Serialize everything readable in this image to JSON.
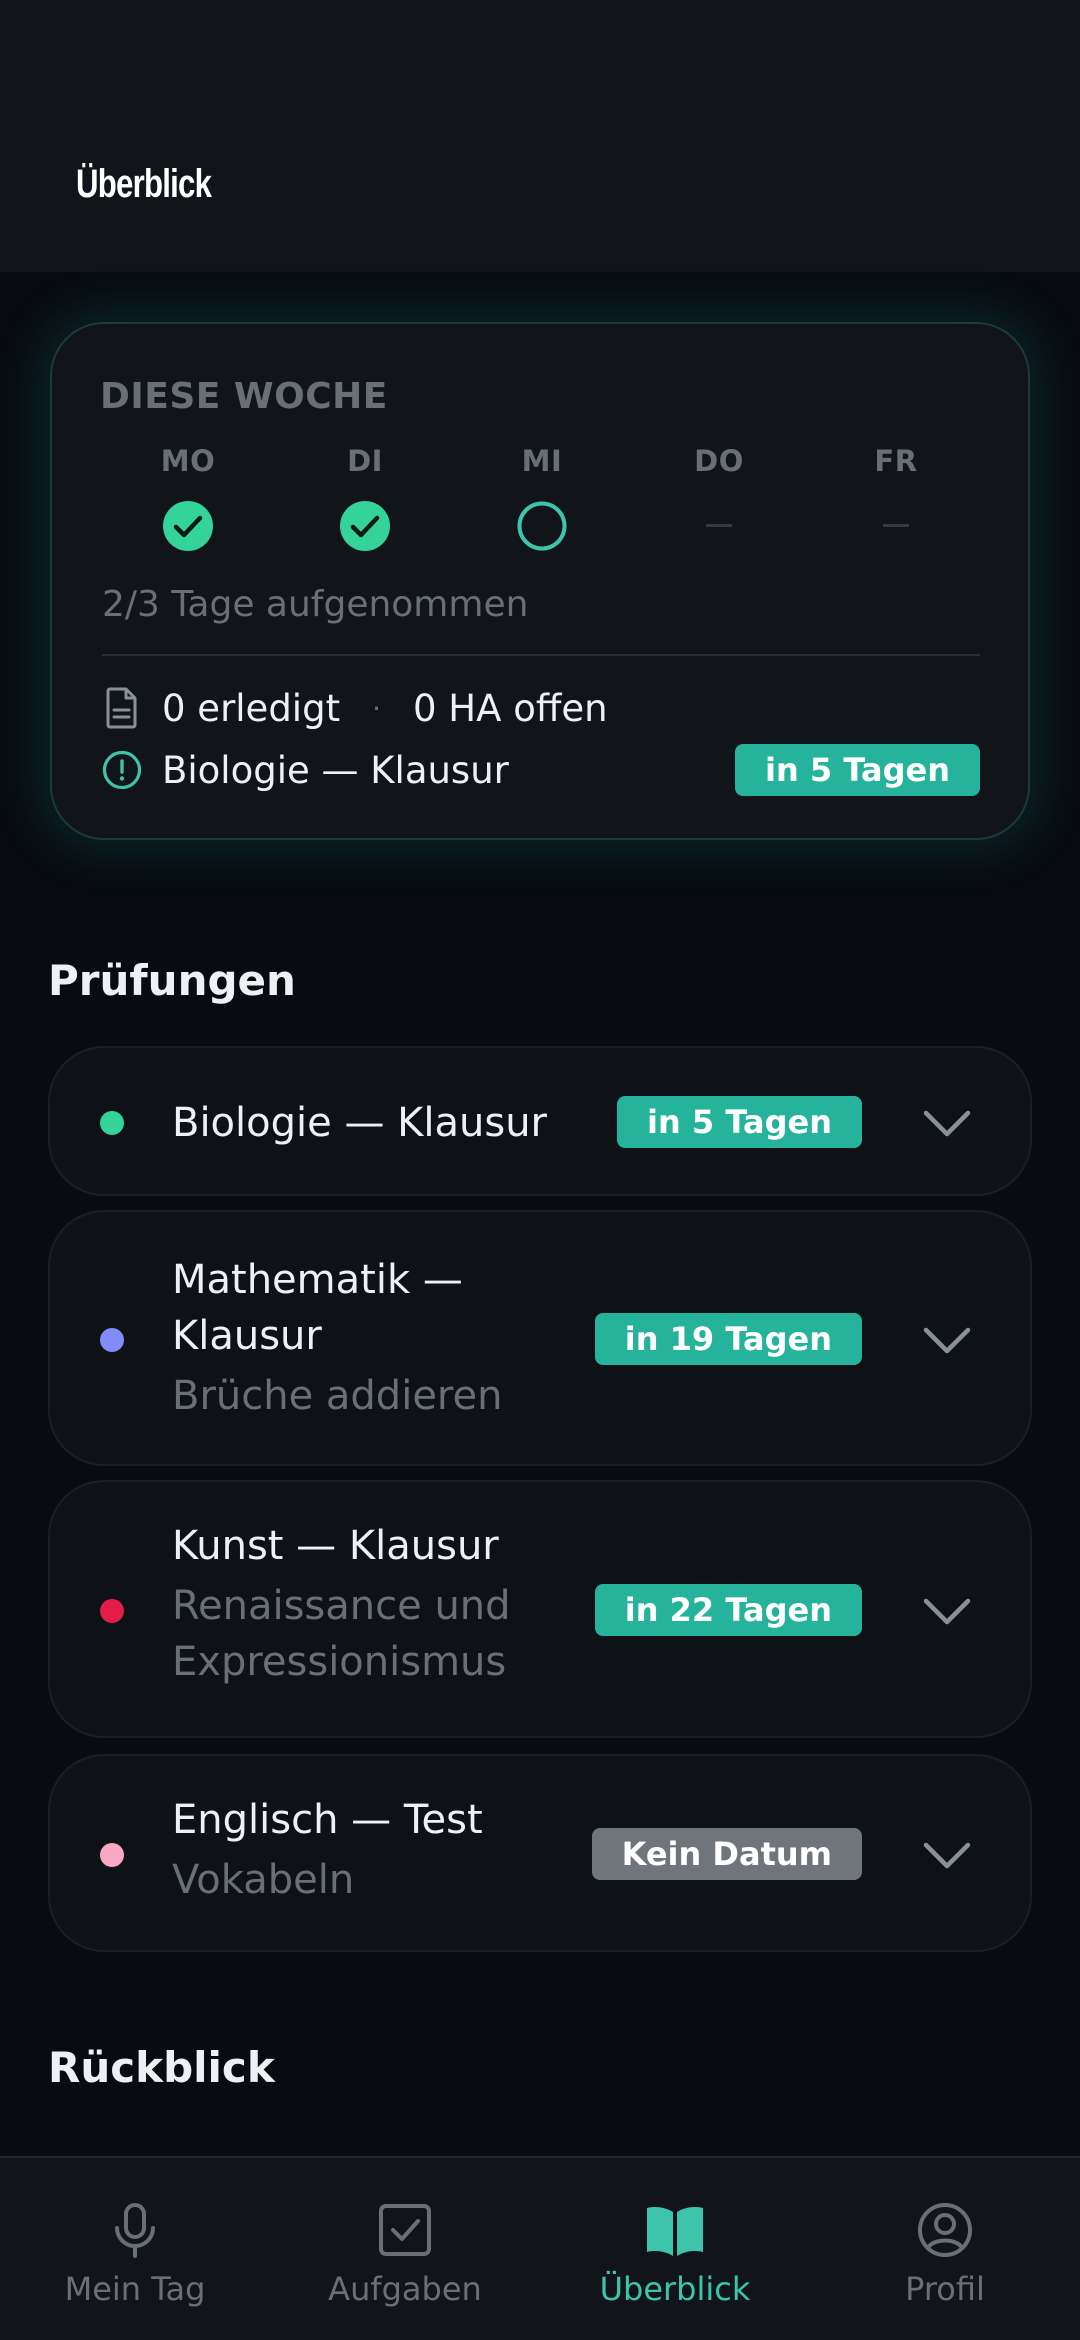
{
  "header": {
    "title": "Überblick"
  },
  "week": {
    "heading": "DIESE WOCHE",
    "days": [
      {
        "label": "MO",
        "state": "done"
      },
      {
        "label": "DI",
        "state": "done"
      },
      {
        "label": "MI",
        "state": "pending"
      },
      {
        "label": "DO",
        "state": "none"
      },
      {
        "label": "FR",
        "state": "none"
      }
    ],
    "days_status": "2/3 Tage aufgenommen",
    "done_text": "0 erledigt",
    "separator": "·",
    "hw_text": "0 HA offen",
    "next_exam": "Biologie — Klausur",
    "next_exam_badge": "in 5 Tagen"
  },
  "exams": {
    "title": "Prüfungen",
    "items": [
      {
        "title": "Biologie — Klausur",
        "subtitle": "",
        "badge": "in 5 Tagen",
        "color": "#34d399",
        "badge_color": "#26b39c"
      },
      {
        "title": "Mathematik — Klausur",
        "subtitle": "Brüche addieren",
        "badge": "in 19 Tagen",
        "color": "#818cf8",
        "badge_color": "#26b39c"
      },
      {
        "title": "Kunst — Klausur",
        "subtitle": "Renaissance und Expressionismus",
        "badge": "in 22 Tagen",
        "color": "#e11d48",
        "badge_color": "#26b39c"
      },
      {
        "title": "Englisch — Test",
        "subtitle": "Vokabeln",
        "badge": "Kein Datum",
        "color": "#f9a8c4",
        "badge_color": "#70757c"
      }
    ]
  },
  "review": {
    "title": "Rückblick"
  },
  "nav": {
    "items": [
      {
        "label": "Mein Tag",
        "icon": "microphone-icon",
        "active": false
      },
      {
        "label": "Aufgaben",
        "icon": "checkbox-icon",
        "active": false
      },
      {
        "label": "Überblick",
        "icon": "book-icon",
        "active": true
      },
      {
        "label": "Profil",
        "icon": "user-circle-icon",
        "active": false
      }
    ]
  },
  "colors": {
    "accent": "#3ec4ab",
    "badge": "#26b39c",
    "card": "#11151a",
    "background": "#080c11"
  }
}
